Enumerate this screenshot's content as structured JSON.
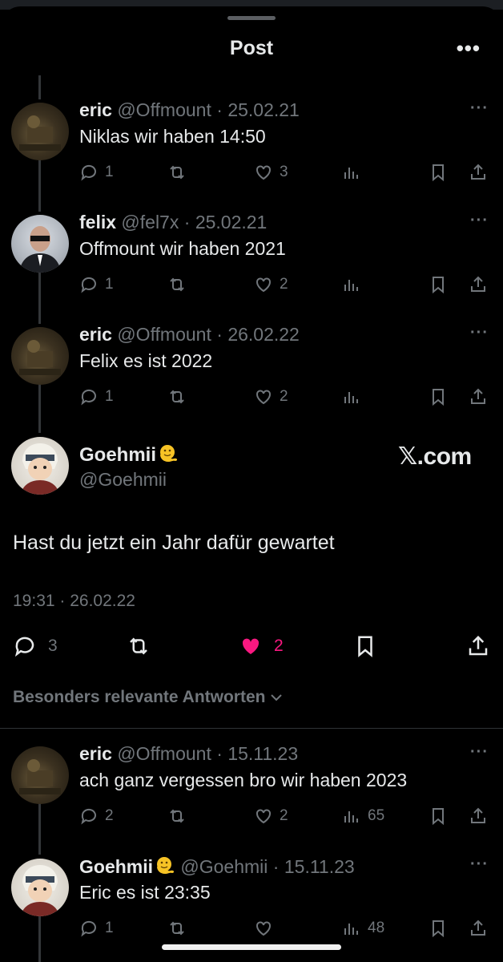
{
  "header": {
    "title": "Post",
    "more_label": "•••"
  },
  "replies_above": [
    {
      "name": "eric",
      "handle": "@Offmount",
      "date": "25.02.21",
      "text": "Niklas wir haben 14:50",
      "replies": "1",
      "likes": "3",
      "views": "",
      "avatar": "eric"
    },
    {
      "name": "felix",
      "handle": "@fel7x",
      "date": "25.02.21",
      "text": "Offmount wir haben 2021",
      "replies": "1",
      "likes": "2",
      "views": "",
      "avatar": "felix"
    },
    {
      "name": "eric",
      "handle": "@Offmount",
      "date": "26.02.22",
      "text": "Felix es ist 2022",
      "replies": "1",
      "likes": "2",
      "views": "",
      "avatar": "eric"
    }
  ],
  "main_post": {
    "name": "Goehmii",
    "handle": "@Goehmii",
    "watermark": "𝕏.com",
    "text": "Hast du jetzt ein Jahr dafür gewartet",
    "timestamp": "19:31 · 26.02.22",
    "replies": "3",
    "likes": "2",
    "like_color": "#f91880"
  },
  "sort": {
    "label": "Besonders relevante Antworten"
  },
  "replies_below": [
    {
      "name": "eric",
      "handle": "@Offmount",
      "date": "15.11.23",
      "text": "ach ganz vergessen bro wir haben 2023",
      "replies": "2",
      "likes": "2",
      "views": "65",
      "avatar": "eric"
    },
    {
      "name": "Goehmii",
      "handle": "@Goehmii",
      "date": "15.11.23",
      "text": "Eric es ist 23:35",
      "replies": "1",
      "likes": "",
      "views": "48",
      "avatar": "goe"
    }
  ],
  "colors": {
    "background": "#000000",
    "text": "#e7e9ea",
    "muted": "#71767b",
    "like": "#f91880"
  }
}
